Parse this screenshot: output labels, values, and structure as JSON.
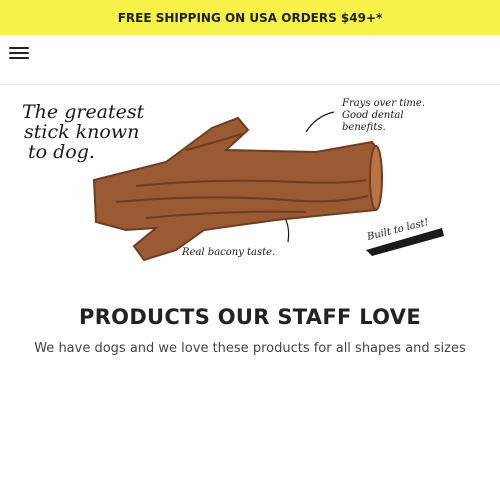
{
  "colors": {
    "promo_bg": "#f7f24a",
    "promo_text": "#222222",
    "stick": "#9a5a34",
    "stick_dark": "#6f3d20"
  },
  "promo": {
    "text": "FREE SHIPPING ON USA ORDERS $49+*"
  },
  "header": {
    "menu_icon": "hamburger-menu-icon"
  },
  "banner": {
    "tagline_line1": "The greatest",
    "tagline_line2": "stick known",
    "tagline_line3": "to dog.",
    "note1_line1": "Frays over time.",
    "note1_line2": "Good dental",
    "note1_line3": "benefits.",
    "note2": "Built to last!",
    "note3": "Real bacony taste."
  },
  "section": {
    "title": "PRODUCTS OUR STAFF LOVE",
    "subtitle": "We have dogs and we love these products for all shapes and sizes"
  }
}
